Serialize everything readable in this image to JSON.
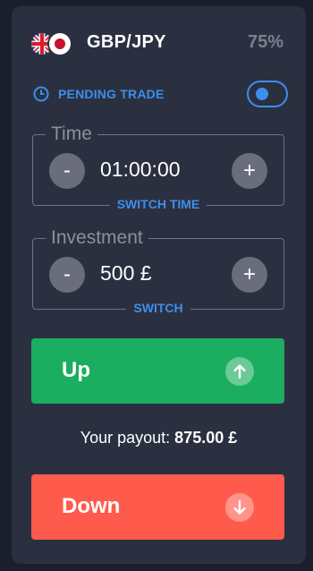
{
  "asset": {
    "name": "GBP/JPY",
    "payout_percent": "75%",
    "flags": [
      "united-kingdom-flag-icon",
      "japan-flag-icon"
    ]
  },
  "pending": {
    "label": "PENDING TRADE",
    "icon": "clock-icon",
    "enabled": true
  },
  "time_field": {
    "legend": "Time",
    "value": "01:00:00",
    "minus_label": "-",
    "plus_label": "+",
    "switch_label": "SWITCH TIME"
  },
  "investment_field": {
    "legend": "Investment",
    "value": "500 £",
    "minus_label": "-",
    "plus_label": "+",
    "switch_label": "SWITCH"
  },
  "up_button": {
    "label": "Up",
    "icon": "arrow-up-icon",
    "color": "#1cae60"
  },
  "payout": {
    "label": "Your payout:",
    "amount": "875.00 £"
  },
  "down_button": {
    "label": "Down",
    "icon": "arrow-down-icon",
    "color": "#ff5b4c"
  },
  "colors": {
    "accent": "#3d8eec",
    "panel": "#2b3040",
    "background": "#1b1e2b"
  }
}
